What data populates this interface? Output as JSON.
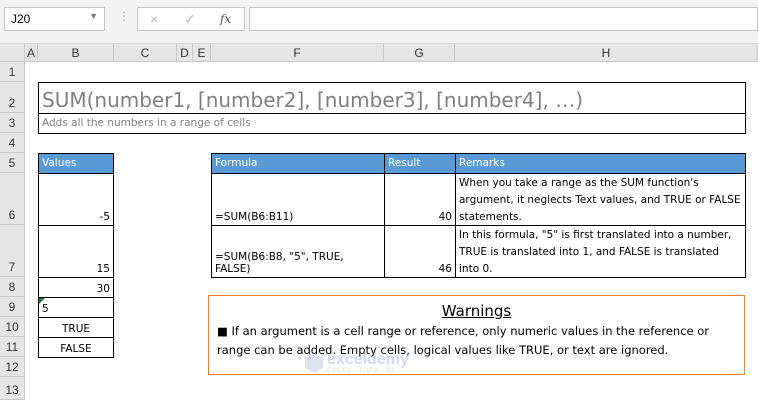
{
  "toolbar": {
    "name_box": "J20",
    "cancel_icon": "×",
    "enter_icon": "✓",
    "fx_label": "fx",
    "formula_value": ""
  },
  "columns": [
    "A",
    "B",
    "C",
    "D",
    "E",
    "F",
    "G",
    "H"
  ],
  "rows": [
    "1",
    "2",
    "3",
    "4",
    "5",
    "6",
    "7",
    "8",
    "9",
    "10",
    "11",
    "12",
    "13"
  ],
  "title": {
    "syntax": "SUM(number1, [number2], [number3], [number4], …)",
    "description": "Adds all the numbers in a range of cells"
  },
  "values_table": {
    "header": "Values",
    "cells": [
      "-5",
      "15",
      "30",
      "5",
      "TRUE",
      "FALSE"
    ]
  },
  "formula_table": {
    "headers": [
      "Formula",
      "Result",
      "Remarks"
    ],
    "rows": [
      {
        "formula": "=SUM(B6:B11)",
        "result": "40",
        "remarks": "When you take a range as the SUM function's argument, it neglects Text values, and TRUE or FALSE statements."
      },
      {
        "formula": "=SUM(B6:B8, \"5\", TRUE, FALSE)",
        "result": "46",
        "remarks": "In this formula, \"5\" is first translated into a number, TRUE is translated into 1, and FALSE is translated into 0."
      }
    ]
  },
  "warnings": {
    "title": "Warnings",
    "text": "■ If an argument is a cell range or reference, only numeric values in the reference or range can be added. Empty cells, logical values like TRUE, or text are ignored."
  },
  "watermark": {
    "brand": "exceldemy",
    "tagline": "EXCEL · DATA · BI"
  },
  "colors": {
    "header_fill": "#5b9bd5",
    "warning_border": "#ed7d31",
    "title_text": "#7f7f7f"
  }
}
